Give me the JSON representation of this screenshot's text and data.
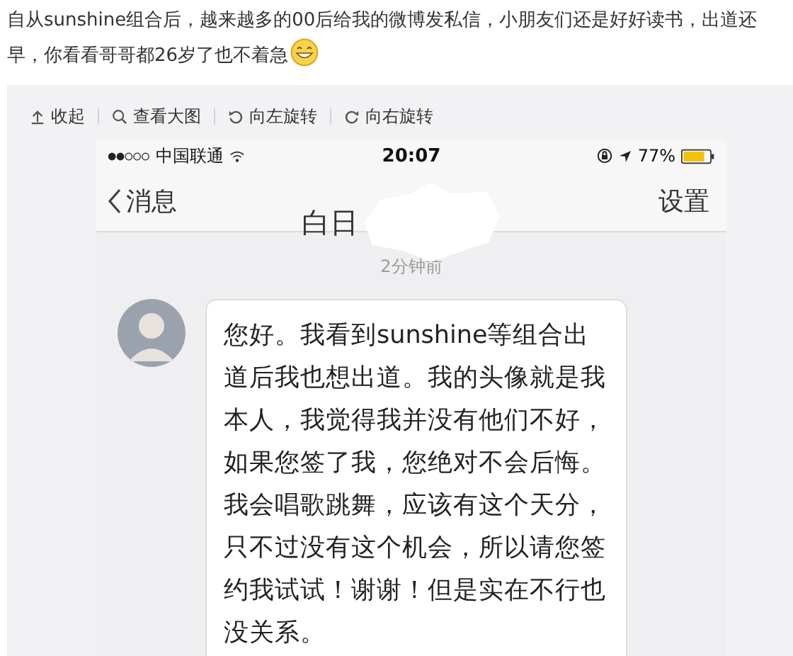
{
  "post": {
    "text": "自从sunshine组合后，越来越多的00后给我的微博发私信，小朋友们还是好好读书，出道还早，你看看哥哥都26岁了也不着急"
  },
  "image_toolbar": [
    {
      "kind": "collapse",
      "label": "收起"
    },
    {
      "kind": "view",
      "label": "查看大图"
    },
    {
      "kind": "rotate_left",
      "label": "向左旋转"
    },
    {
      "kind": "rotate_right",
      "label": "向右旋转"
    }
  ],
  "phone": {
    "status_bar": {
      "carrier": "中国联通",
      "time": "20:07",
      "battery": "77%"
    },
    "nav": {
      "back": "消息",
      "title": "白日",
      "action": "设置"
    },
    "chat": {
      "timestamp": "2分钟前",
      "message": "您好。我看到sunshine等组合出道后我也想出道。我的头像就是我本人，我觉得我并没有他们不好，如果您签了我，您绝对不会后悔。我会唱歌跳舞，应该有这个天分，只不过没有这个机会，所以请您签约我试试！谢谢！但是实在不行也没关系。"
    }
  }
}
